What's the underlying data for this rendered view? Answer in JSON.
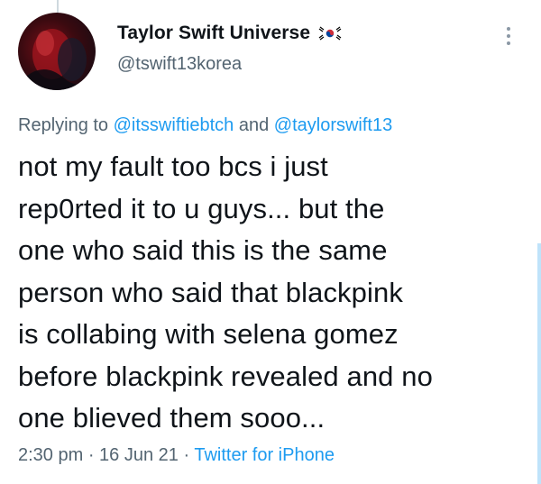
{
  "tweet": {
    "display_name": "Taylor Swift Universe",
    "flag_icon": "south-korea-flag-icon",
    "handle": "@tswift13korea",
    "replying_prefix": "Replying to ",
    "mention_1": "@itsswiftiebtch",
    "replying_joiner": " and ",
    "mention_2": "@taylorswift13",
    "body": "not my fault too bcs i just\nrep0rted it to u guys... but the\none who said this is the same\nperson who said that blackpink\nis collabing with selena gomez\nbefore blackpink revealed and no\none blieved them sooo...",
    "time": "2:30 pm",
    "separator_1": " · ",
    "date": "16 Jun 21",
    "separator_2": " · ",
    "source": "Twitter for iPhone"
  },
  "colors": {
    "link": "#1d9bf0",
    "secondary_text": "#536471",
    "primary_text": "#0f1419"
  }
}
